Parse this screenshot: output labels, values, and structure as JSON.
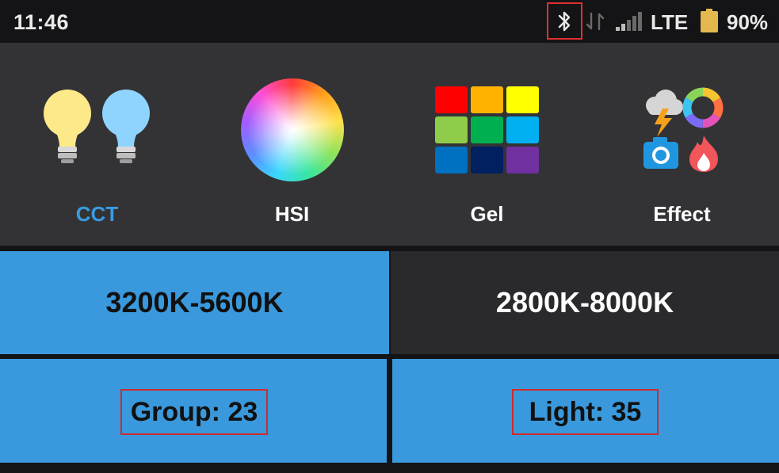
{
  "status_bar": {
    "time": "11:46",
    "network": "LTE",
    "battery": "90%",
    "icons": [
      "bluetooth-icon",
      "data-sync-icon",
      "signal-icon",
      "battery-icon"
    ]
  },
  "modes": [
    {
      "label": "CCT",
      "icon": "bulbs-icon",
      "active": true
    },
    {
      "label": "HSI",
      "icon": "color-wheel-icon",
      "active": false
    },
    {
      "label": "Gel",
      "icon": "gel-grid-icon",
      "active": false
    },
    {
      "label": "Effect",
      "icon": "effects-icon",
      "active": false
    }
  ],
  "gel_colors": [
    "#ff0000",
    "#ffb300",
    "#ffff00",
    "#8fcc4a",
    "#00b050",
    "#00b0f0",
    "#0070c0",
    "#002060",
    "#7030a0"
  ],
  "ranges": [
    {
      "label": "3200K-5600K",
      "selected": true
    },
    {
      "label": "2800K-8000K",
      "selected": false
    }
  ],
  "info": {
    "group": "Group: 23",
    "light": "Light: 35"
  },
  "colors": {
    "accent": "#3a99dc",
    "highlight_box": "#d02a2a",
    "panel": "#333336",
    "background": "#141416"
  }
}
